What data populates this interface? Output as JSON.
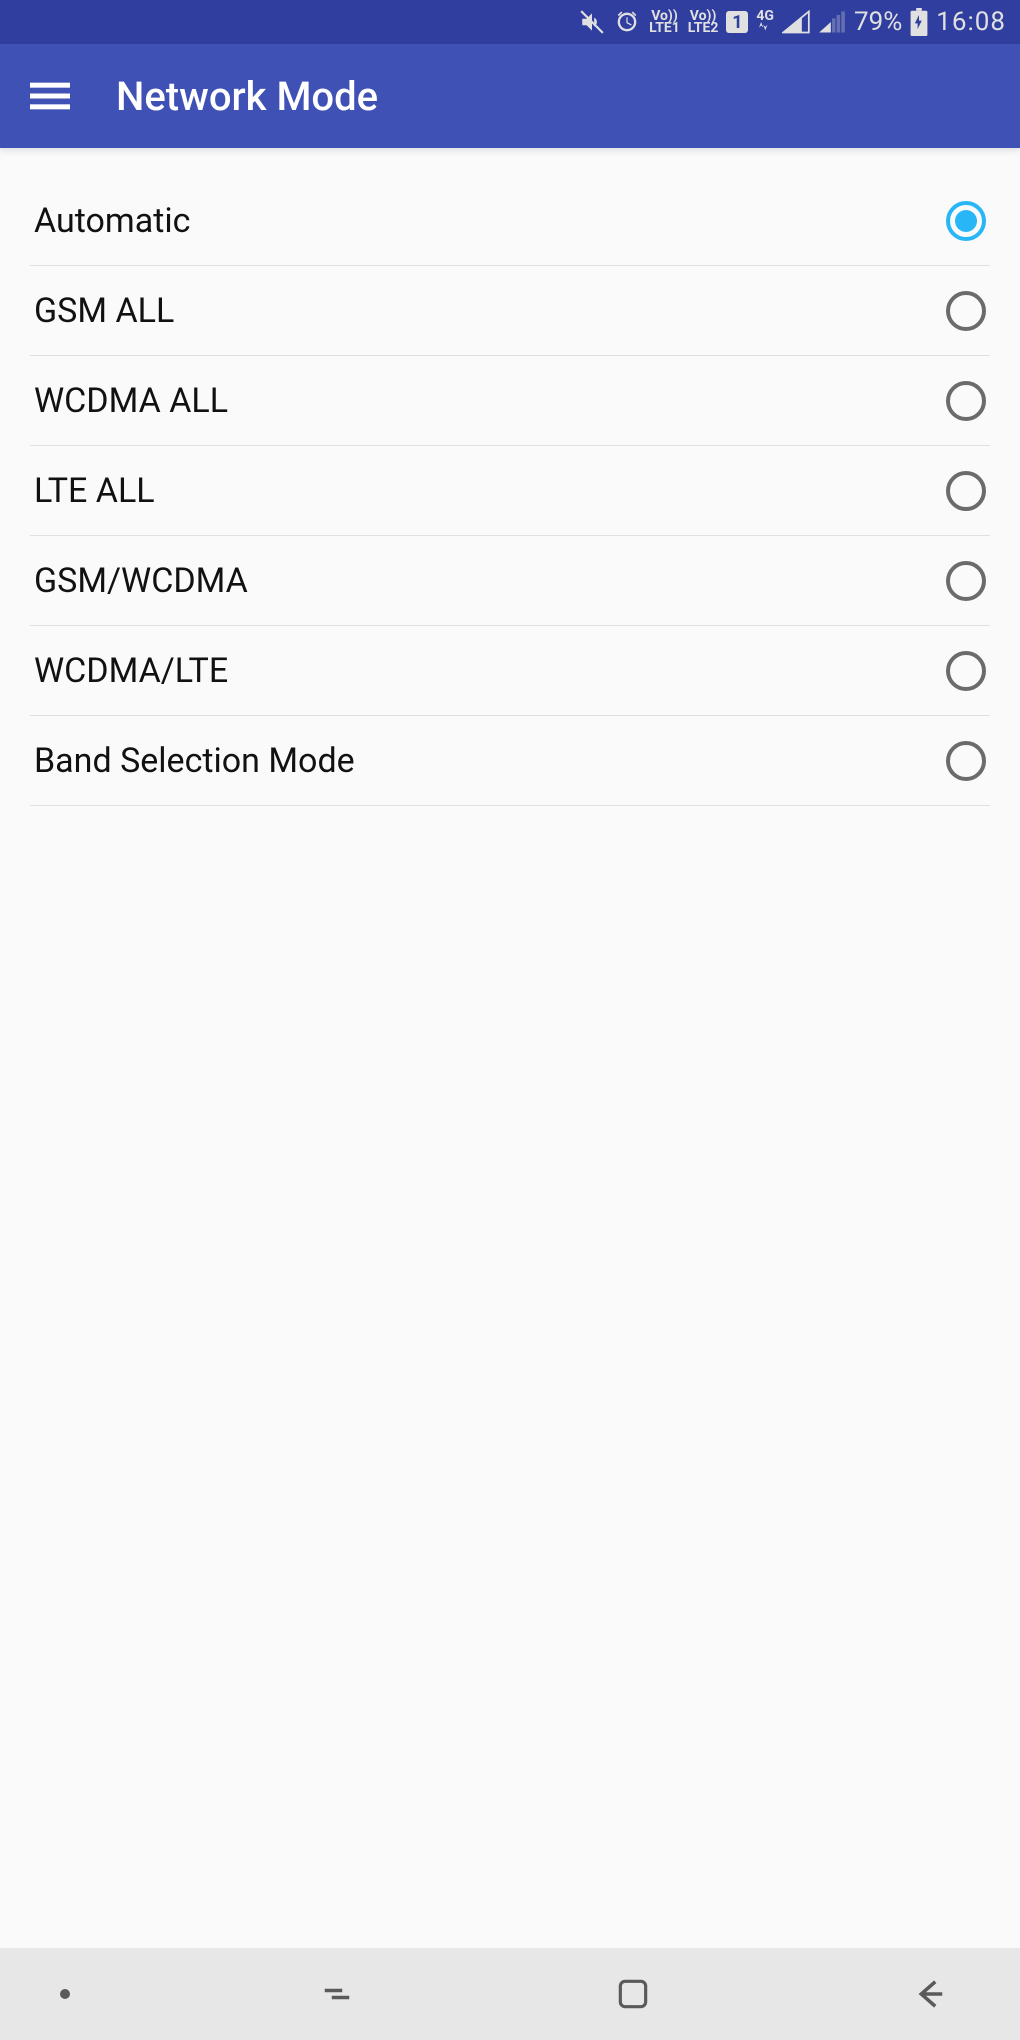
{
  "status": {
    "mute": true,
    "alarm": true,
    "volte1_top": "Vo))",
    "volte1_bot": "LTE1",
    "volte2_top": "Vo))",
    "volte2_bot": "LTE2",
    "sim_badge": "1",
    "data_type": "4G",
    "battery_pct": "79%",
    "time": "16:08"
  },
  "appbar": {
    "title": "Network Mode"
  },
  "options": [
    {
      "label": "Automatic",
      "selected": true
    },
    {
      "label": "GSM ALL",
      "selected": false
    },
    {
      "label": "WCDMA ALL",
      "selected": false
    },
    {
      "label": "LTE ALL",
      "selected": false
    },
    {
      "label": "GSM/WCDMA",
      "selected": false
    },
    {
      "label": "WCDMA/LTE",
      "selected": false
    },
    {
      "label": "Band Selection Mode",
      "selected": false
    }
  ]
}
